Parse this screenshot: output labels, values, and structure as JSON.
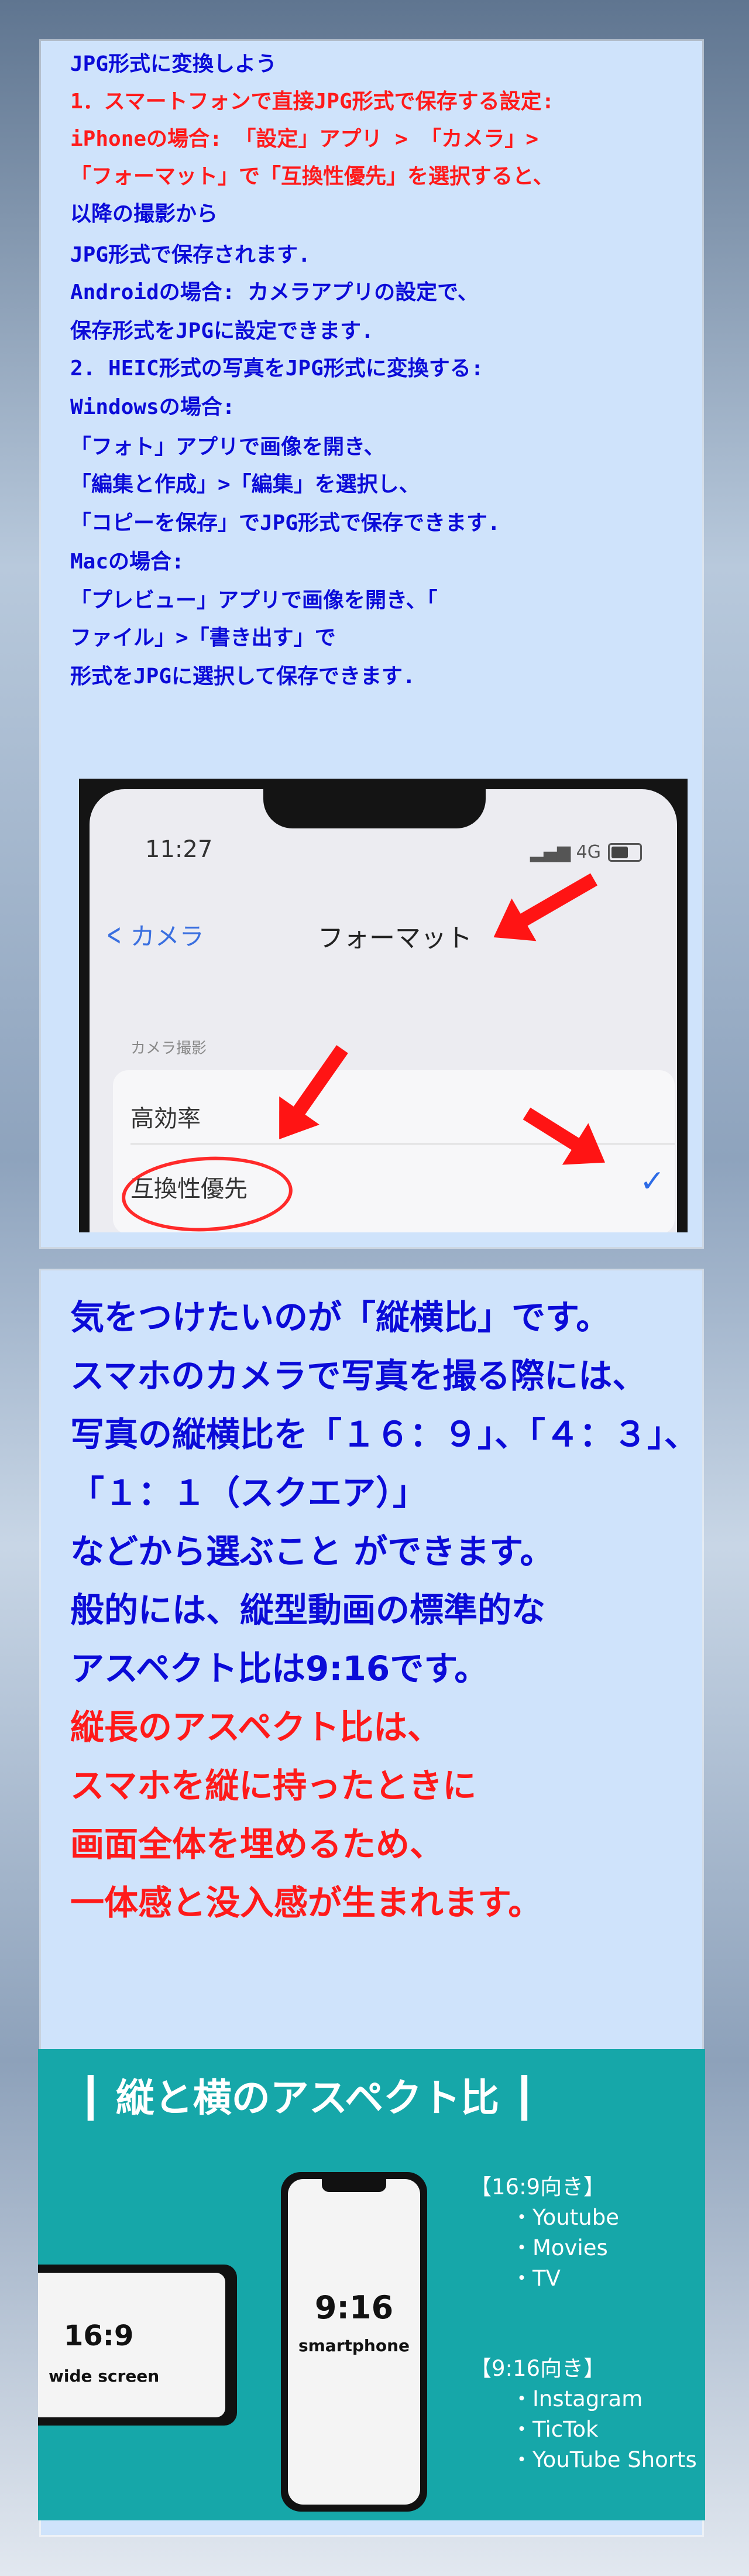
{
  "panel1": {
    "lines": [
      {
        "text": "JPG形式に変換しよう",
        "color": "blue"
      },
      {
        "text": "1．スマートフォンで直接JPG形式で保存する設定:",
        "color": "red"
      },
      {
        "text": "iPhoneの場合: 「設定」アプリ > 「カメラ」>",
        "color": "red"
      },
      {
        "text": "「フォーマット」で「互換性優先」を選択すると、",
        "color": "red"
      },
      {
        "text": "以降の撮影から",
        "color": "blue"
      },
      {
        "text": "JPG形式で保存されます.",
        "color": "blue"
      },
      {
        "text": "Androidの場合: カメラアプリの設定で、",
        "color": "blue"
      },
      {
        "text": "保存形式をJPGに設定できます.",
        "color": "blue"
      },
      {
        "text": "2. HEIC形式の写真をJPG形式に変換する:",
        "color": "blue"
      },
      {
        "text": "Windowsの場合:",
        "color": "blue"
      },
      {
        "text": "「フォト」アプリで画像を開き、",
        "color": "blue"
      },
      {
        "text": "「編集と作成」>「編集」を選択し、",
        "color": "blue"
      },
      {
        "text": "「コピーを保存」でJPG形式で保存できます.",
        "color": "blue"
      },
      {
        "text": "Macの場合:",
        "color": "blue"
      },
      {
        "text": "「プレビュー」アプリで画像を開き、「",
        "color": "blue"
      },
      {
        "text": "ファイル」>「書き出す」で",
        "color": "blue"
      },
      {
        "text": "形式をJPGに選択して保存できます.",
        "color": "blue"
      }
    ],
    "phone": {
      "time": "11:27",
      "signal": "4G",
      "back_label": "カメラ",
      "title": "フォーマット",
      "section": "カメラ撮影",
      "option1": "高効率",
      "option2": "互換性優先",
      "check": "✓"
    }
  },
  "panel2": {
    "lines": [
      {
        "text": "気をつけたいのが「縦横比」です。",
        "color": "blue"
      },
      {
        "text": "スマホのカメラで写真を撮る際には、",
        "color": "blue"
      },
      {
        "text": "写真の縦横比を「１６：９」、「４：３」、",
        "color": "blue"
      },
      {
        "text": "「１：１（スクエア）」",
        "color": "blue"
      },
      {
        "text": "などから選ぶこと ができます。",
        "color": "blue"
      },
      {
        "text": "般的には、縦型動画の標準的な",
        "color": "blue"
      },
      {
        "text": "アスペクト比は9:16です。",
        "color": "blue"
      },
      {
        "text": "縦長のアスペクト比は、",
        "color": "red"
      },
      {
        "text": "スマホを縦に持ったときに",
        "color": "red"
      },
      {
        "text": "画面全体を埋めるため、",
        "color": "red"
      },
      {
        "text": "一体感と没入感が生まれます。",
        "color": "red"
      }
    ],
    "aspect": {
      "title": "┃ 縦と横のアスペクト比 ┃",
      "landscape_ratio": "16:9",
      "landscape_label": "wide screen",
      "portrait_ratio": "9:16",
      "portrait_label": "smartphone",
      "group1_heading": "【16:9向き】",
      "group1_items": [
        "・Youtube",
        "・Movies",
        "・TV"
      ],
      "group2_heading": "【9:16向き】",
      "group2_items": [
        "・Instagram",
        "・TicTok",
        "・YouTube Shorts"
      ]
    }
  },
  "colors": {
    "blue": "#0b0bd8",
    "red": "#ff1a1a",
    "panel": "#cfe3fb",
    "teal": "#16a7a9"
  }
}
